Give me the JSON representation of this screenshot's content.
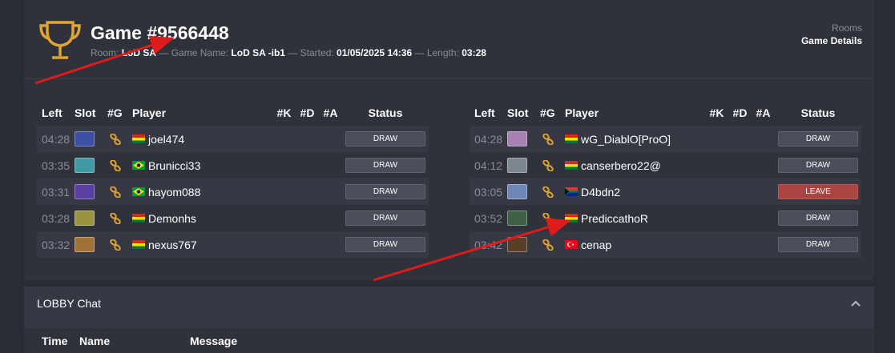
{
  "header": {
    "title": "Game #9566448",
    "meta": {
      "room_label": "Room:",
      "room_value": "LoD SA",
      "game_name_label": "Game Name:",
      "game_name_value": "LoD SA -ib1",
      "started_label": "Started:",
      "started_value": "01/05/2025 14:36",
      "length_label": "Length:",
      "length_value": "03:28",
      "separator": "—"
    },
    "breadcrumb": {
      "parent": "Rooms",
      "current": "Game Details"
    }
  },
  "columns": {
    "left": "Left",
    "slot": "Slot",
    "g": "#G",
    "player": "Player",
    "k": "#K",
    "d": "#D",
    "a": "#A",
    "status": "Status"
  },
  "teams": [
    {
      "players": [
        {
          "left": "04:28",
          "slot_color": "#3d4fa5",
          "flag": "bolivia",
          "name": "joel474",
          "status": "DRAW"
        },
        {
          "left": "03:35",
          "slot_color": "#3f9aa6",
          "flag": "brazil",
          "name": "Brunicci33",
          "status": "DRAW"
        },
        {
          "left": "03:31",
          "slot_color": "#5b3ea3",
          "flag": "brazil",
          "name": "hayom088",
          "status": "DRAW"
        },
        {
          "left": "03:28",
          "slot_color": "#9a9440",
          "flag": "bolivia",
          "name": "Demonhs",
          "status": "DRAW"
        },
        {
          "left": "03:32",
          "slot_color": "#a0723a",
          "flag": "bolivia",
          "name": "nexus767",
          "status": "DRAW"
        }
      ]
    },
    {
      "players": [
        {
          "left": "04:28",
          "slot_color": "#a77fb0",
          "flag": "bolivia",
          "name": "wG_DiablO[ProO]",
          "status": "DRAW"
        },
        {
          "left": "04:12",
          "slot_color": "#7d8590",
          "flag": "bolivia",
          "name": "canserbero22@",
          "status": "DRAW"
        },
        {
          "left": "03:05",
          "slot_color": "#6e87b8",
          "flag": "south-africa",
          "name": "D4bdn2",
          "status": "LEAVE"
        },
        {
          "left": "03:52",
          "slot_color": "#3e6047",
          "flag": "bolivia",
          "name": "PrediccathoR",
          "status": "DRAW"
        },
        {
          "left": "03:42",
          "slot_color": "#5a3f28",
          "flag": "turkey",
          "name": "cenap",
          "status": "DRAW"
        }
      ]
    }
  ],
  "chat": {
    "title": "LOBBY Chat",
    "columns": {
      "time": "Time",
      "name": "Name",
      "message": "Message"
    }
  },
  "colors": {
    "accent": "#e2a432",
    "leave": "#a94442",
    "annotation_arrow": "#e01b1b"
  },
  "icons": {
    "trophy": "trophy-icon",
    "link": "link-icon",
    "collapse": "chevron-up-icon"
  }
}
